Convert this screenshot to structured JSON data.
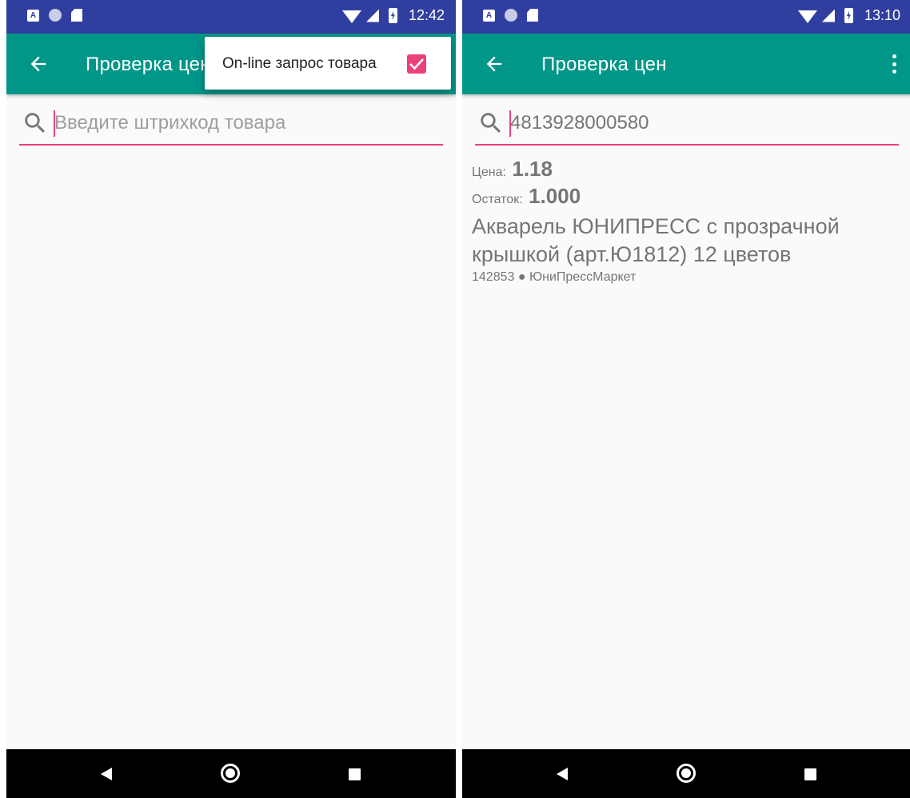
{
  "left": {
    "status": {
      "time": "12:42",
      "icon_a": "A"
    },
    "app_bar": {
      "title": "Проверка цен",
      "back_icon": "arrow-left-icon"
    },
    "popup": {
      "label": "On-line запрос товара",
      "checked": true
    },
    "search": {
      "placeholder": "Введите штрихкод товара",
      "value": ""
    }
  },
  "right": {
    "status": {
      "time": "13:10",
      "icon_a": "A"
    },
    "app_bar": {
      "title": "Проверка цен",
      "back_icon": "arrow-left-icon",
      "menu_icon": "more-vert-icon"
    },
    "search": {
      "placeholder": "Введите штрихкод товара",
      "value": "4813928000580"
    },
    "result": {
      "price_label": "Цена:",
      "price_value": "1.18",
      "stock_label": "Остаток:",
      "stock_value": "1.000",
      "name": "Акварель ЮНИПРЕСС с прозрачной крышкой (арт.Ю1812) 12 цветов",
      "meta": "142853 ● ЮниПрессМаркет"
    }
  },
  "colors": {
    "status_bar": "#303f9f",
    "app_bar": "#009688",
    "accent": "#ec407a"
  }
}
